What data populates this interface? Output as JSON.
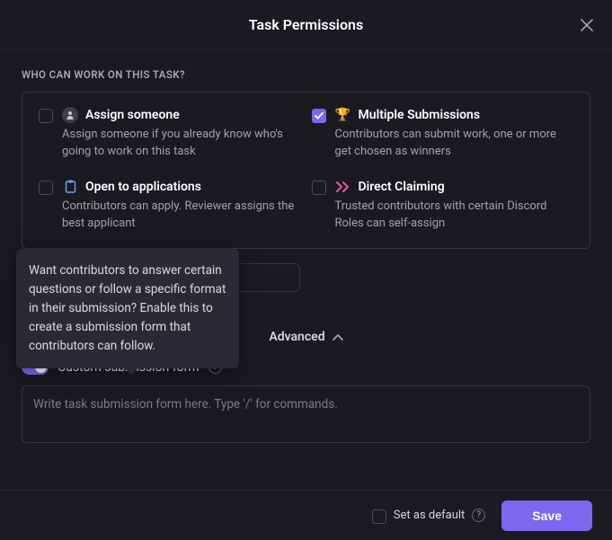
{
  "header": {
    "title": "Task Permissions"
  },
  "section_label": "WHO CAN WORK ON THIS TASK?",
  "permissions": {
    "assign": {
      "title": "Assign someone",
      "desc": "Assign someone if you already know who's going to work on this task",
      "checked": false
    },
    "multiple": {
      "title": "Multiple Submissions",
      "desc": "Contributors can submit work, one or more get chosen as winners",
      "checked": true
    },
    "open": {
      "title": "Open to applications",
      "desc": "Contributors can apply. Reviewer assigns the best applicant",
      "checked": false
    },
    "direct": {
      "title": "Direct Claiming",
      "desc": "Trusted contributors with certain Discord Roles can self-assign",
      "checked": false
    }
  },
  "advanced_label": "Advanced",
  "custom_form": {
    "label": "Custom submission form",
    "placeholder": "Write task submission form here. Type '/' for commands.",
    "enabled": true
  },
  "tooltip_text": "Want contributors to answer certain questions or follow a specific format in their submission? Enable this to create a submission form that contributors can follow.",
  "footer": {
    "default_label": "Set as default",
    "save_label": "Save"
  }
}
